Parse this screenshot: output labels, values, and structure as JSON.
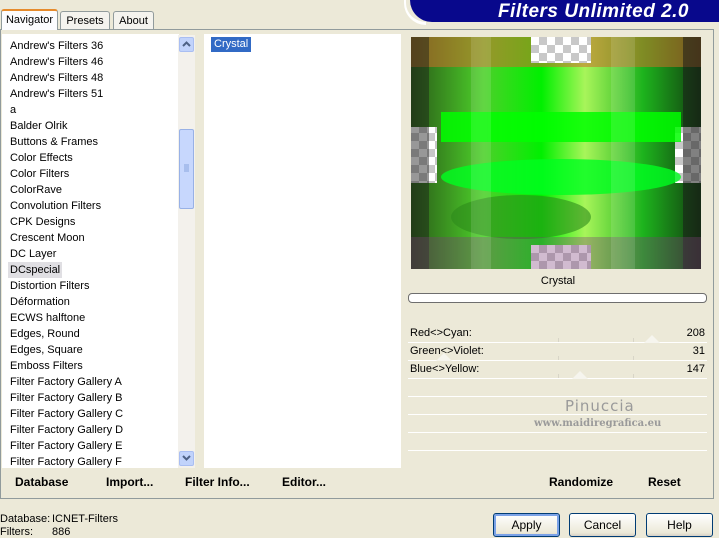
{
  "tabs": [
    {
      "label": "Navigator",
      "active": true
    },
    {
      "label": "Presets",
      "active": false
    },
    {
      "label": "About",
      "active": false
    }
  ],
  "app_title": "Filters Unlimited 2.0",
  "categories": [
    "Andrew's Filters 36",
    "Andrew's Filters 46",
    "Andrew's Filters 48",
    "Andrew's Filters 51",
    "a",
    "Balder Olrik",
    "Buttons & Frames",
    "Color Effects",
    "Color Filters",
    "ColorRave",
    "Convolution Filters",
    "CPK Designs",
    "Crescent Moon",
    "DC Layer",
    "DCspecial",
    "Distortion Filters",
    "Déformation",
    "ECWS halftone",
    "Edges, Round",
    "Edges, Square",
    "Emboss Filters",
    "Filter Factory Gallery A",
    "Filter Factory Gallery B",
    "Filter Factory Gallery C",
    "Filter Factory Gallery D",
    "Filter Factory Gallery E",
    "Filter Factory Gallery F"
  ],
  "selected_category": "DCspecial",
  "filters": [
    "Crystal"
  ],
  "preview_caption": "Crystal",
  "controls": [
    {
      "label": "Red<>Cyan:",
      "value": "208",
      "level": 0.816
    },
    {
      "label": "Green<>Violet:",
      "value": "31",
      "level": 0.122
    },
    {
      "label": "Blue<>Yellow:",
      "value": "147",
      "level": 0.576
    }
  ],
  "watermark": {
    "main": "Pinuccia",
    "url": "www.maidiregrafica.eu"
  },
  "bottom_bar": {
    "database": "Database",
    "import": "Import...",
    "filter_info": "Filter Info...",
    "editor": "Editor...",
    "randomize": "Randomize",
    "reset": "Reset"
  },
  "status": {
    "database_label": "Database:",
    "database_value": "ICNET-Filters",
    "filters_label": "Filters:",
    "filters_value": "886"
  },
  "buttons": {
    "apply": "Apply",
    "cancel": "Cancel",
    "help": "Help"
  },
  "colors": {
    "banner": "#08088c",
    "selection": "#316ac5",
    "tab_accent": "#e68b2c"
  },
  "icons": {
    "scroll_up": "chevron-up-icon",
    "scroll_down": "chevron-down-icon"
  }
}
